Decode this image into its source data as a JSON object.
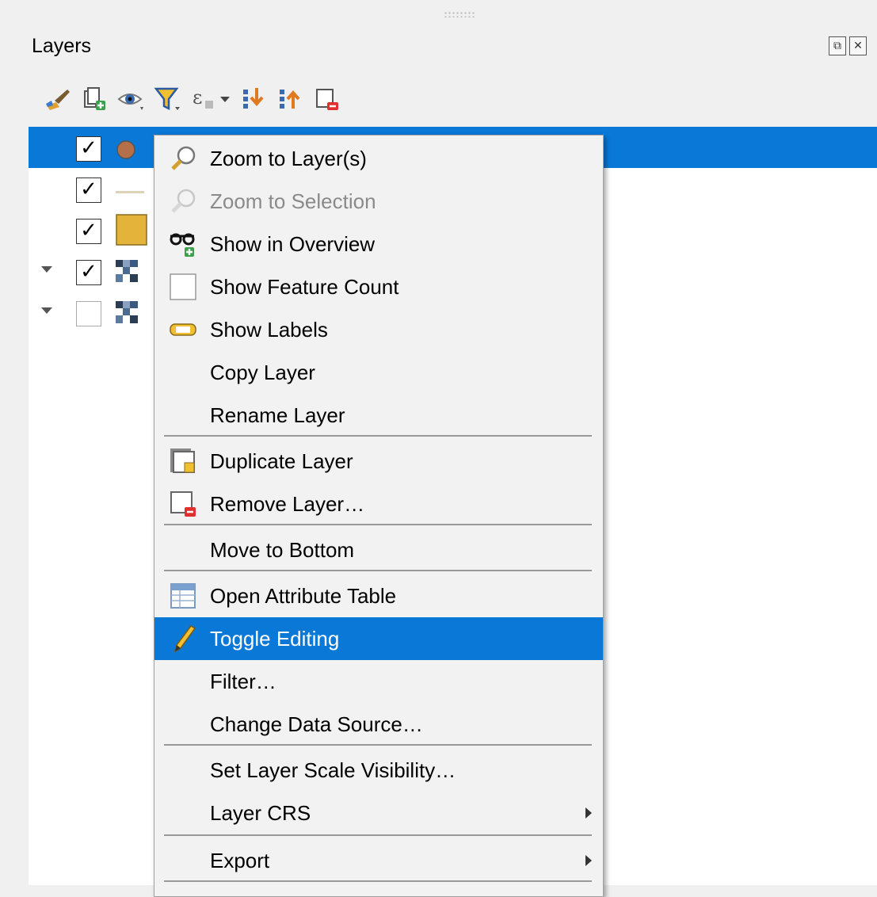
{
  "panel": {
    "title": "Layers",
    "float_icon": "⧉",
    "close_icon": "✕"
  },
  "toolbar": {
    "buttons": [
      {
        "name": "style-manager-icon"
      },
      {
        "name": "add-group-icon"
      },
      {
        "name": "manage-visibility-icon"
      },
      {
        "name": "filter-legend-icon"
      },
      {
        "name": "filter-by-expression-icon"
      },
      {
        "name": "dropdown-arrow-icon"
      },
      {
        "name": "expand-all-icon"
      },
      {
        "name": "collapse-all-icon"
      },
      {
        "name": "remove-layer-icon"
      }
    ]
  },
  "tree": {
    "check_glyph": "✓",
    "layers": [
      {
        "checked": true,
        "symbol": "point",
        "selected": true,
        "expandable": false
      },
      {
        "checked": true,
        "symbol": "line",
        "selected": false,
        "expandable": false
      },
      {
        "checked": true,
        "symbol": "polygon",
        "selected": false,
        "expandable": false
      },
      {
        "checked": true,
        "symbol": "raster",
        "selected": false,
        "expandable": true
      },
      {
        "checked": false,
        "symbol": "raster",
        "selected": false,
        "expandable": true
      }
    ]
  },
  "colors": {
    "selection": "#0a78d7",
    "point": "#b5704a",
    "polygon": "#e4b33a",
    "line": "#ddd3b8"
  },
  "context_menu": {
    "items": [
      {
        "label": "Zoom to Layer(s)",
        "icon": "zoom-icon",
        "disabled": false
      },
      {
        "label": "Zoom to Selection",
        "icon": "zoom-selection-icon",
        "disabled": true
      },
      {
        "label": "Show in Overview",
        "icon": "overview-icon",
        "disabled": false
      },
      {
        "label": "Show Feature Count",
        "icon": "checkbox-icon",
        "disabled": false
      },
      {
        "label": "Show Labels",
        "icon": "labels-icon",
        "disabled": false
      },
      {
        "label": "Copy Layer",
        "icon": "",
        "disabled": false
      },
      {
        "label": "Rename Layer",
        "icon": "",
        "disabled": false
      },
      {
        "label": "Duplicate Layer",
        "icon": "duplicate-layer-icon",
        "disabled": false
      },
      {
        "label": "Remove Layer…",
        "icon": "remove-layer-icon",
        "disabled": false
      },
      {
        "label": "Move to Bottom",
        "icon": "",
        "disabled": false
      },
      {
        "label": "Open Attribute Table",
        "icon": "attribute-table-icon",
        "disabled": false
      },
      {
        "label": "Toggle Editing",
        "icon": "pencil-icon",
        "disabled": false,
        "active": true
      },
      {
        "label": "Filter…",
        "icon": "",
        "disabled": false
      },
      {
        "label": "Change Data Source…",
        "icon": "",
        "disabled": false
      },
      {
        "label": "Set Layer Scale Visibility…",
        "icon": "",
        "disabled": false
      },
      {
        "label": "Layer CRS",
        "icon": "",
        "disabled": false,
        "submenu": true
      },
      {
        "label": "Export",
        "icon": "",
        "disabled": false,
        "submenu": true
      }
    ]
  }
}
